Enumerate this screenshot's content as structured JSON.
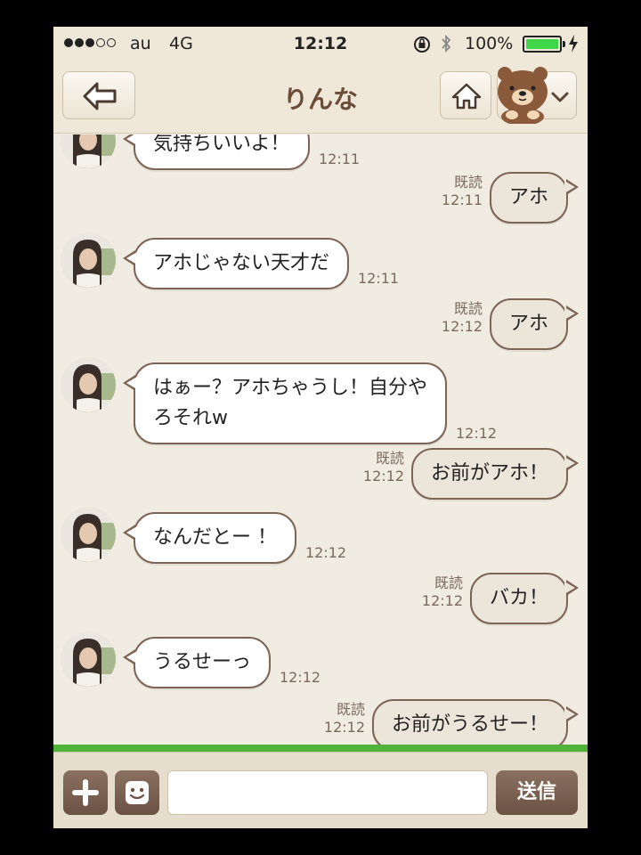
{
  "status_bar": {
    "carrier": "au",
    "network": "4G",
    "time": "12:12",
    "battery": "100%",
    "battery_level": 1.0,
    "battery_color": "#3fd64a"
  },
  "nav": {
    "title": "りんな"
  },
  "messages": [
    {
      "side": "in",
      "text": "気持ちいいよ！",
      "time": "12:11"
    },
    {
      "side": "out",
      "text": "アホ",
      "read": "既読",
      "time": "12:11"
    },
    {
      "side": "in",
      "text": "アホじゃない天才だ",
      "time": "12:11"
    },
    {
      "side": "out",
      "text": "アホ",
      "read": "既読",
      "time": "12:12"
    },
    {
      "side": "in",
      "lines": [
        "はぁー？アホちゃうし！自分や",
        "ろそれw"
      ],
      "time": "12:12"
    },
    {
      "side": "out",
      "text": "お前がアホ！",
      "read": "既読",
      "time": "12:12"
    },
    {
      "side": "in",
      "text": "なんだとー ！",
      "time": "12:12"
    },
    {
      "side": "out",
      "text": "バカ！",
      "read": "既読",
      "time": "12:12"
    },
    {
      "side": "in",
      "text": "うるせーっ",
      "time": "12:12"
    },
    {
      "side": "out",
      "text": "お前がうるせー！",
      "read": "既読",
      "time": "12:12"
    }
  ],
  "input": {
    "value": "",
    "send_label": "送信"
  },
  "colors": {
    "accent_brown": "#6b4d3a",
    "background": "#f1ece2",
    "bubble_border": "#7c6556",
    "green_strip": "#52b33b"
  }
}
